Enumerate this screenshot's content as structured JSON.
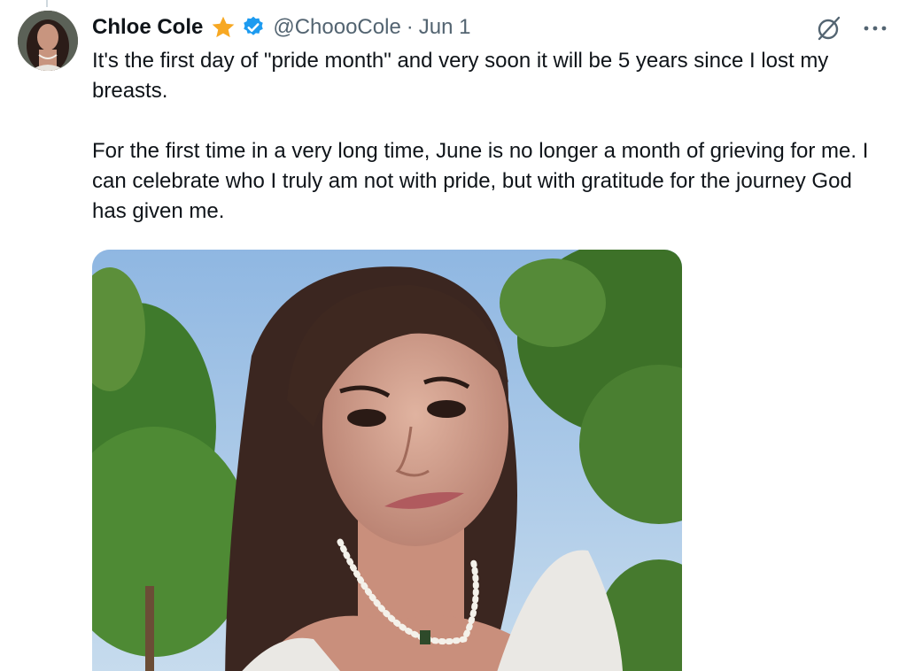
{
  "author": {
    "name": "Chloe Cole",
    "handle": "@ChoooCole",
    "separator": "·",
    "date": "Jun 1",
    "badges": [
      "star-icon",
      "verified-icon"
    ]
  },
  "tweet": {
    "text": "It's the first day of \"pride month\" and very soon it will be 5 years since I lost my breasts.\n\nFor the first time in a very long time, June is no longer a month of grieving for me. I can celebrate who I truly am not with pride, but with gratitude for the journey God has given me."
  },
  "actions": {
    "icons": [
      "grok-icon",
      "more-icon"
    ]
  },
  "colors": {
    "text": "#0f1419",
    "secondary": "#536471",
    "star": "#f7a823",
    "verified": "#1d9bf0"
  }
}
